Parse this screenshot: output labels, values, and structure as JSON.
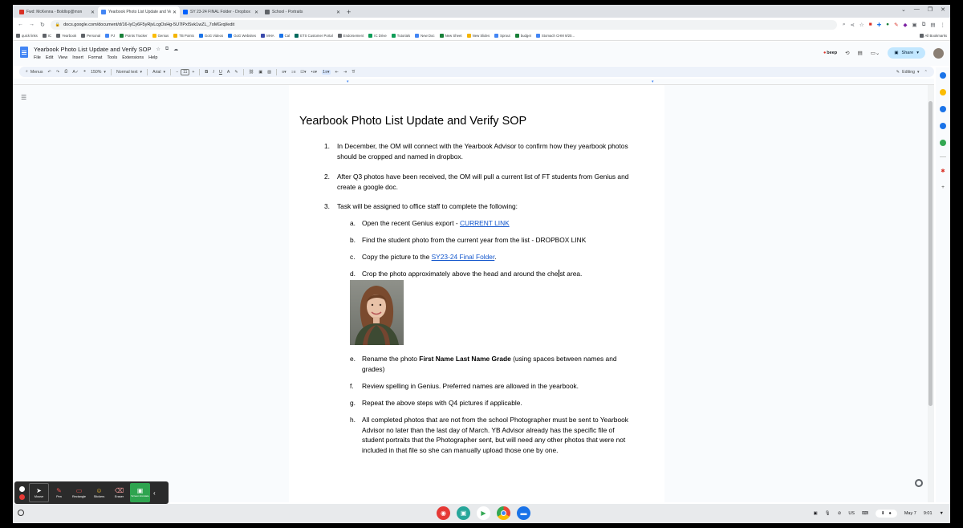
{
  "browser": {
    "tabs": [
      {
        "title": "Fwd: McKenna - Boldlop@mon",
        "color": "#d93025",
        "active": false
      },
      {
        "title": "Yearbook Photo List Update and Verify SOP",
        "color": "#4285f4",
        "active": true
      },
      {
        "title": "SY 23-24 FINAL Folder - Dropbox",
        "color": "#0061fe",
        "active": false
      },
      {
        "title": "School - Portraits",
        "color": "#5f6368",
        "active": false
      }
    ],
    "url": "docs.google.com/document/d/16-lyCy6F5yRjvLcgOsHg-5U7lPxlSvk1wZL_7oMGrql/edit",
    "bookmarks": [
      "quick links",
      "IC",
      "Yearbook",
      "Personal",
      "PJ",
      "Points Tracker",
      "Genius",
      "TB Points",
      "GoG Videos",
      "GoG Websites",
      "MHA",
      "Cal",
      "ETS Customer Portal",
      "Endorsement",
      "IC Drive",
      "Tutorials",
      "New Doc",
      "New Sheet",
      "New Slides",
      "Sprout",
      "budget",
      "Stomach CHM 9/20..."
    ],
    "all_bookmarks": "All Bookmarks"
  },
  "docs": {
    "title": "Yearbook Photo List Update and Verify SOP",
    "menu": [
      "File",
      "Edit",
      "View",
      "Insert",
      "Format",
      "Tools",
      "Extensions",
      "Help"
    ],
    "beep": "beep",
    "share": "Share",
    "toolbar": {
      "menus": "Menus",
      "zoom": "150%",
      "style": "Normal text",
      "font": "Arial",
      "font_size": "11",
      "mode": "Editing"
    }
  },
  "document": {
    "heading": "Yearbook Photo List Update and Verify SOP",
    "items": [
      {
        "num": "1.",
        "lines": [
          "In December, the OM will connect with the Yearbook Advisor to confirm how they yearbook photos",
          "should be cropped and named in dropbox."
        ]
      },
      {
        "num": "2.",
        "lines": [
          "After Q3 photos have been received, the OM will pull a current list of FT students from Genius and",
          "create a google doc."
        ]
      },
      {
        "num": "3.",
        "lines": [
          "Task will be assigned to office staff to complete the following:"
        ]
      }
    ],
    "sub": {
      "a_letter": "a.",
      "a_text": "Open the recent Genius export - ",
      "a_link": "CURRENT LINK",
      "b_letter": "b.",
      "b_text": "Find the student photo from the current year from the list - DROPBOX LINK",
      "c_letter": "c.",
      "c_text": "Copy the picture to the ",
      "c_link": "SY23-24 Final Folder",
      "c_end": ".",
      "d_letter": "d.",
      "d_pre": "Crop the photo approximately above the head and around the che",
      "d_post": "st area.",
      "e_letter": "e.",
      "e_pre": "Rename the photo ",
      "e_bold": "First Name Last Name Grade",
      "e_post": " (using spaces between names and",
      "e_line2": "grades)",
      "f_letter": "f.",
      "f_text": "Review spelling in Genius. Preferred names are allowed in the yearbook.",
      "g_letter": "g.",
      "g_text": "Repeat the above steps with Q4 pictures if applicable.",
      "h_letter": "h.",
      "h_lines": [
        "All completed photos that are not from the school Photographer must be sent to Yearbook",
        "Advisor no later than the last day of March. YB Advisor already has the specific file of",
        "student portraits that the Photographer sent, but will need any other photos that were not",
        "included in that file so she can manually upload those one by one."
      ]
    }
  },
  "annotation_toolbar": {
    "tools": [
      "Mouse",
      "Pen",
      "Rectangle",
      "Stickers",
      "Eraser",
      "Screen Annotate"
    ]
  },
  "shelf": {
    "input_method": "US",
    "date": "May 7",
    "time": "9:01"
  }
}
